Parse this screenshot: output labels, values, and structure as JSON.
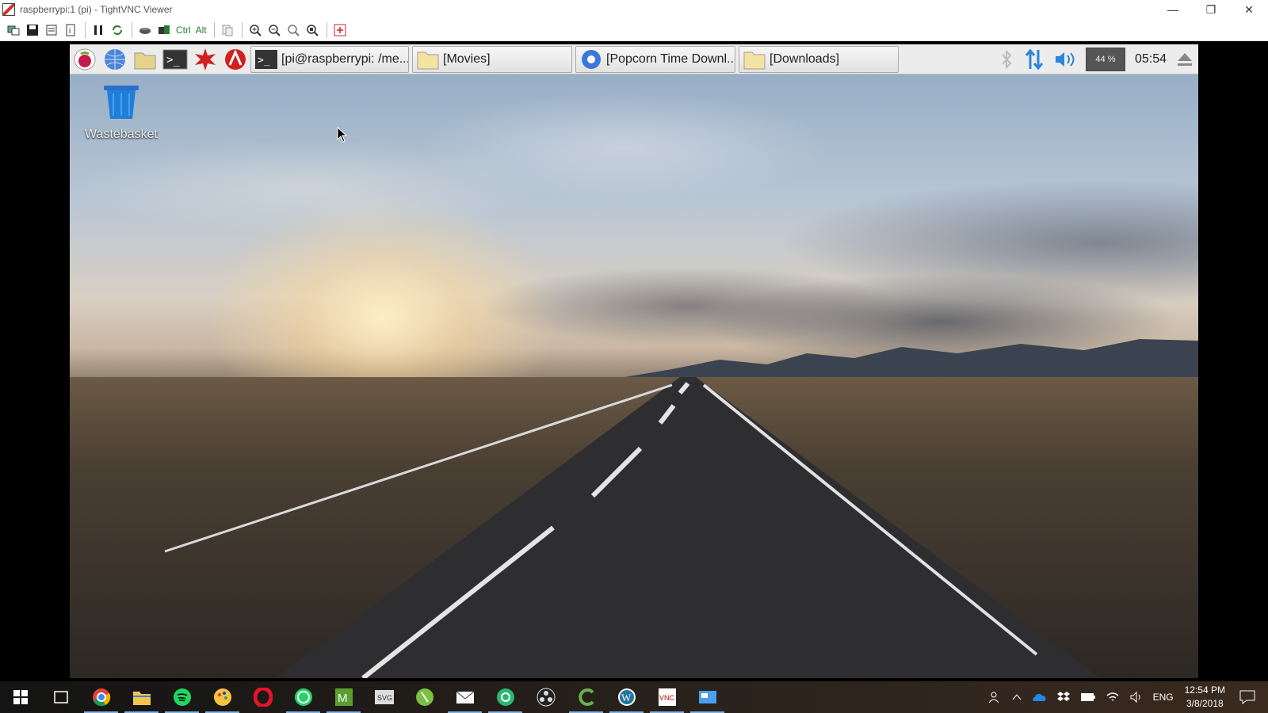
{
  "window": {
    "title": "raspberrypi:1 (pi) - TightVNC Viewer",
    "controls": [
      "minimize-icon",
      "restore-icon",
      "close-icon"
    ]
  },
  "vnc_toolbar": {
    "ctrl_label": "Ctrl",
    "alt_label": "Alt",
    "icons": [
      "new-connection-icon",
      "save-icon",
      "options-icon",
      "info-icon",
      "pause-icon",
      "refresh-icon",
      "ctrl-alt-del-icon",
      "ctrl-esc-icon",
      "ctrl-key-icon",
      "alt-key-icon",
      "clipboard-icon",
      "zoom-in-icon",
      "zoom-out-icon",
      "zoom-100-icon",
      "zoom-fit-icon",
      "fullscreen-icon"
    ]
  },
  "pi_panel": {
    "launchers": [
      "raspberry-menu-icon",
      "web-browser-icon",
      "file-manager-icon",
      "terminal-icon",
      "mathematica-icon",
      "wolfram-icon"
    ],
    "tasks": [
      {
        "label": "[pi@raspberrypi: /me...",
        "icon": "terminal-icon"
      },
      {
        "label": "[Movies]",
        "icon": "folder-icon"
      },
      {
        "label": "[Popcorn Time Downl...",
        "icon": "chromium-icon"
      },
      {
        "label": "[Downloads]",
        "icon": "folder-icon"
      }
    ],
    "tray": {
      "bluetooth_icon": "bluetooth-icon",
      "network_icon": "network-arrows-icon",
      "volume_icon": "volume-icon",
      "cpu": "44 %",
      "clock": "05:54",
      "eject_icon": "eject-icon"
    }
  },
  "desktop": {
    "icons": [
      {
        "label": "Wastebasket",
        "icon": "wastebasket-icon"
      }
    ]
  },
  "windows_taskbar": {
    "apps": [
      "chrome-icon",
      "file-explorer-icon",
      "spotify-icon",
      "paint-icon",
      "opera-icon",
      "whatsapp-icon",
      "mendeley-icon",
      "svg-icon",
      "evernote-icon",
      "mail-icon",
      "app-icon",
      "obs-icon",
      "greenshot-icon",
      "wordpress-icon",
      "tightvnc-icon",
      "remote-desktop-icon"
    ],
    "active": [
      "chrome-icon",
      "file-explorer-icon",
      "spotify-icon",
      "paint-icon",
      "whatsapp-icon",
      "mendeley-icon",
      "mail-icon",
      "app-icon",
      "greenshot-icon",
      "wordpress-icon",
      "tightvnc-icon",
      "remote-desktop-icon"
    ],
    "tray": {
      "language": "ENG",
      "time": "12:54 PM",
      "date": "3/8/2018"
    }
  }
}
